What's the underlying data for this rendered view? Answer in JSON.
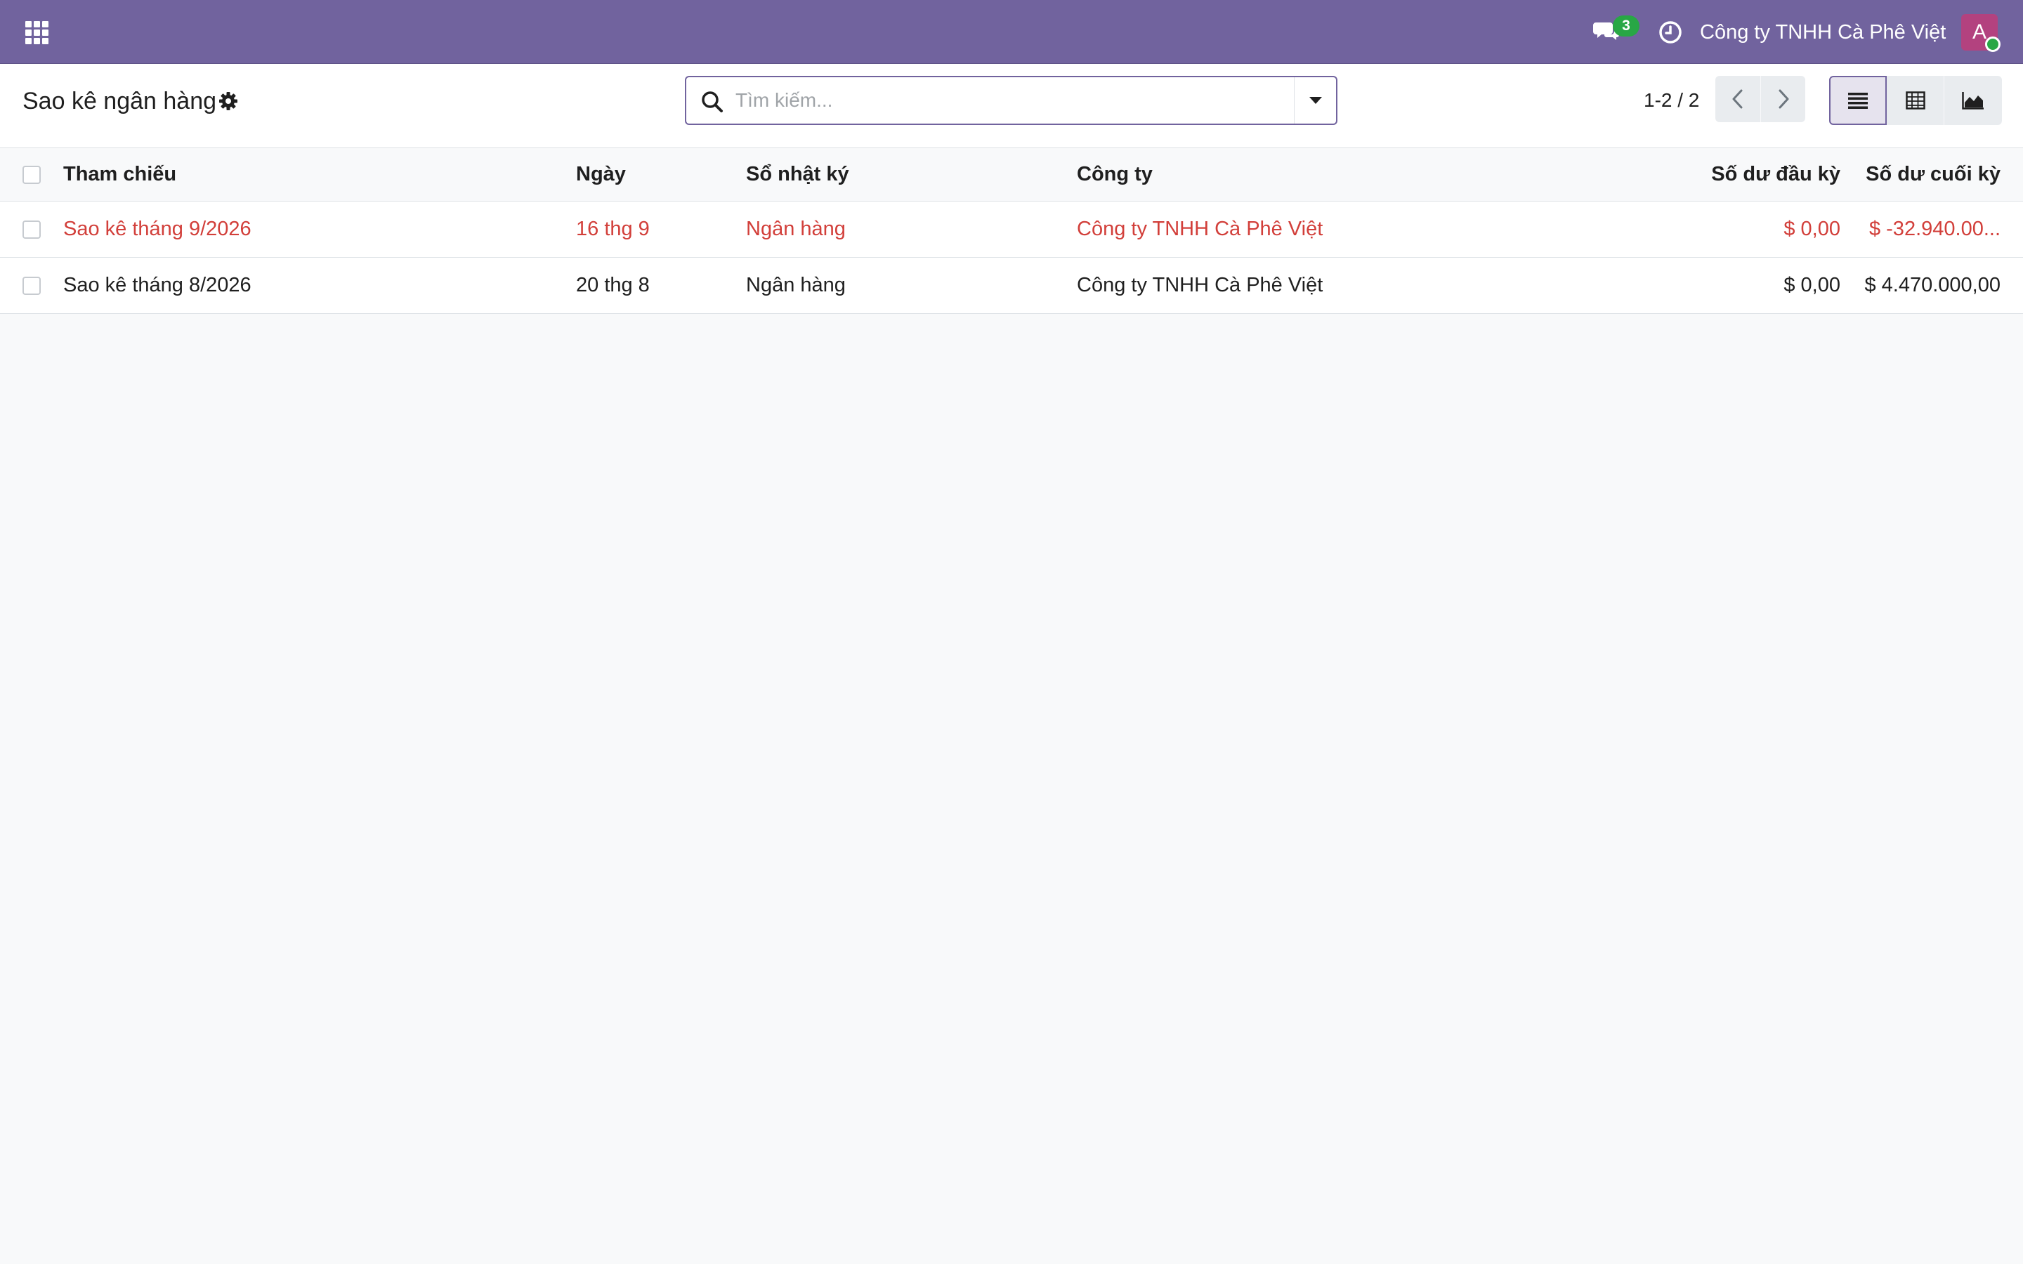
{
  "navbar": {
    "apps_icon": "apps-grid-icon",
    "chat_icon": "chat-bubbles-icon",
    "chat_badge": "3",
    "activity_icon": "clock-icon",
    "company_name": "Công ty TNHH Cà Phê Việt",
    "avatar_initial": "A",
    "brand_color": "#71639e",
    "avatar_color": "#b3427f"
  },
  "control_panel": {
    "title": "Sao kê ngân hàng",
    "settings_icon": "gear-icon",
    "search": {
      "placeholder": "Tìm kiếm...",
      "value": ""
    },
    "pager": {
      "value": "1-2 / 2",
      "prev_icon": "chevron-left-icon",
      "next_icon": "chevron-right-icon"
    },
    "views": [
      {
        "name": "list",
        "icon": "list-view-icon",
        "active": true
      },
      {
        "name": "pivot",
        "icon": "pivot-view-icon",
        "active": false
      },
      {
        "name": "graph",
        "icon": "graph-view-icon",
        "active": false
      }
    ]
  },
  "table": {
    "columns": {
      "reference": "Tham chiếu",
      "date": "Ngày",
      "journal": "Sổ nhật ký",
      "company": "Công ty",
      "balance_start": "Số dư đầu kỳ",
      "balance_end": "Số dư cuối kỳ"
    },
    "rows": [
      {
        "reference": "Sao kê tháng 9/2026",
        "date": "16 thg 9",
        "journal": "Ngân hàng",
        "company": "Công ty TNHH Cà Phê Việt",
        "balance_start": "$ 0,00",
        "balance_end": "$ -32.940.00...",
        "status_color": "#d23f3a"
      },
      {
        "reference": "Sao kê tháng 8/2026",
        "date": "20 thg 8",
        "journal": "Ngân hàng",
        "company": "Công ty TNHH Cà Phê Việt",
        "balance_start": "$ 0,00",
        "balance_end": "$ 4.470.000,00"
      }
    ]
  }
}
